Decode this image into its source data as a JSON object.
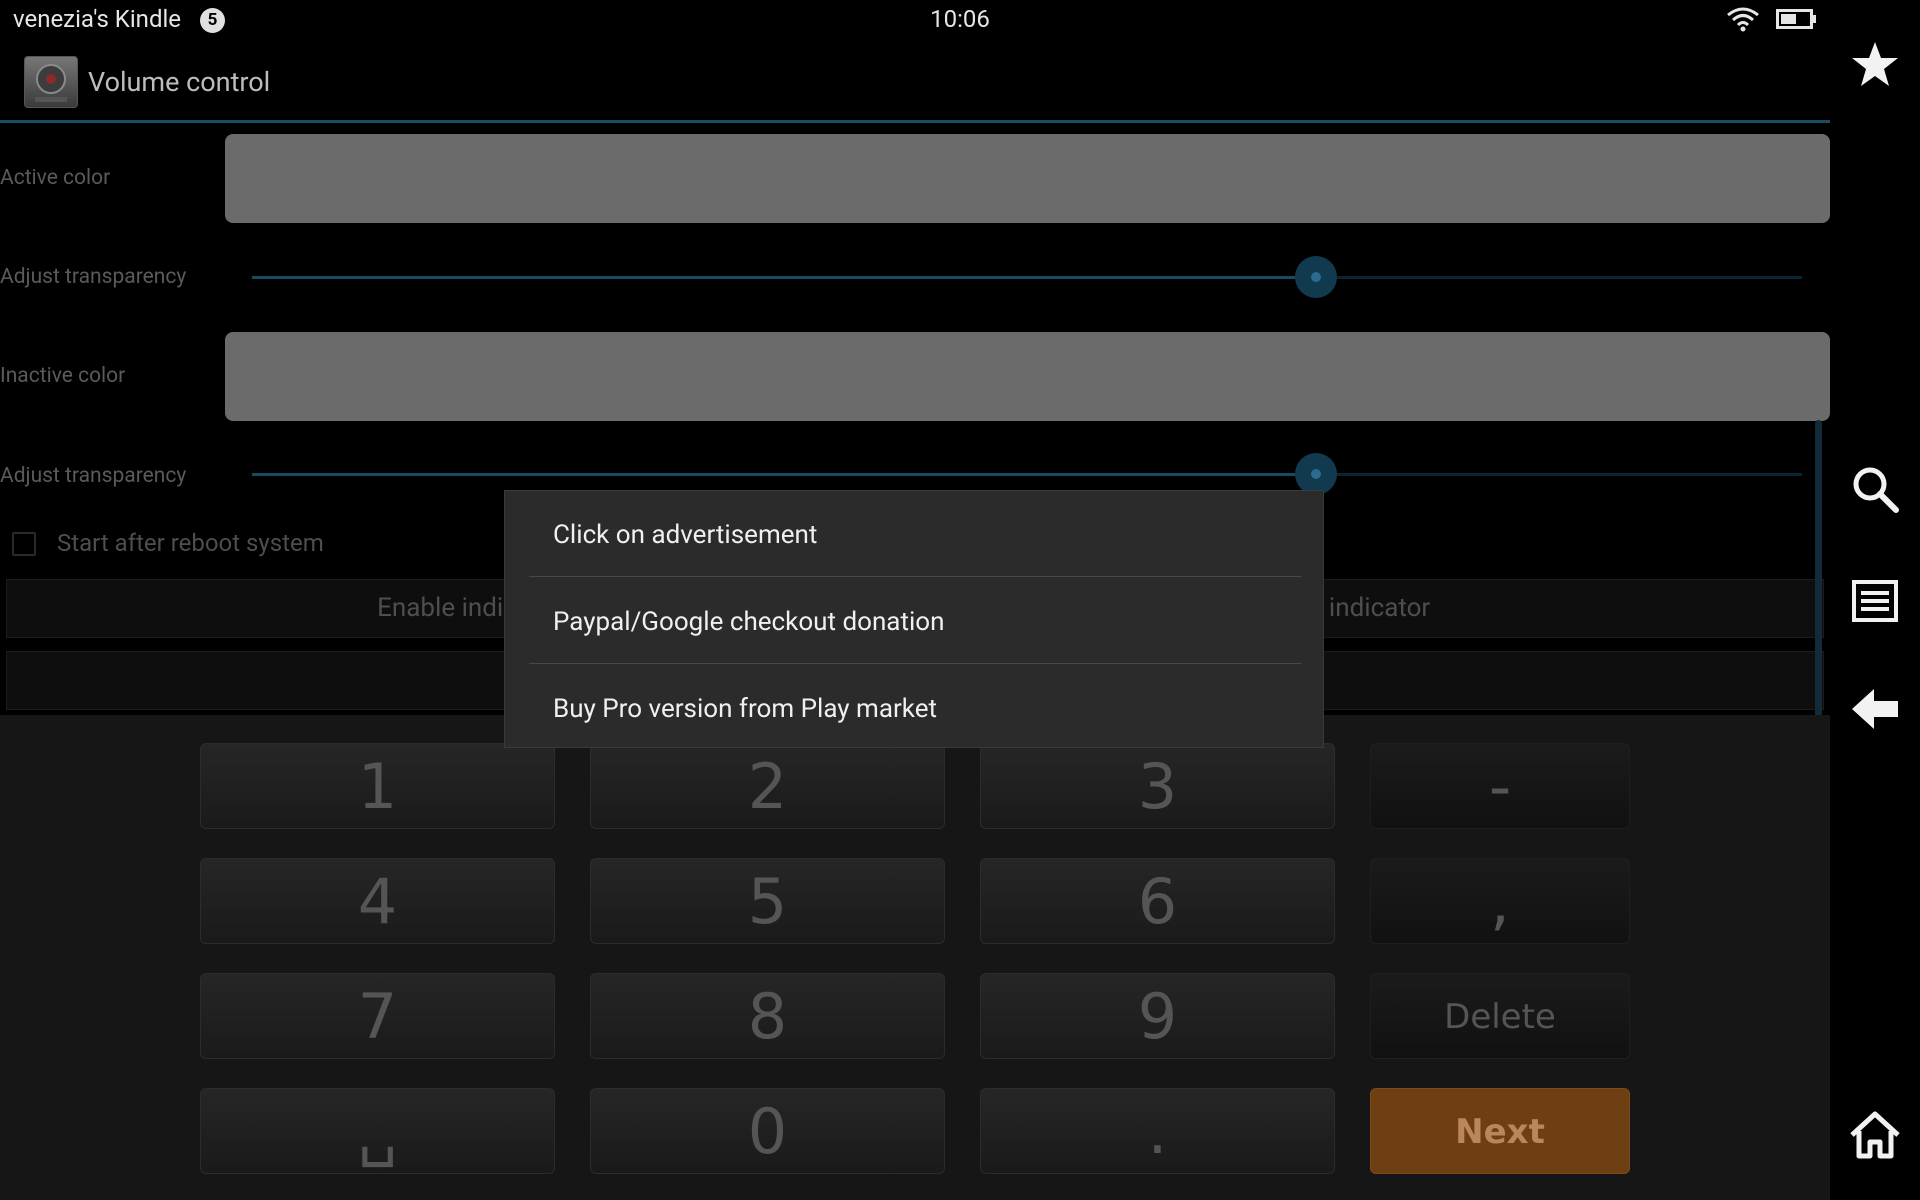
{
  "status_bar": {
    "device_name": "venezia's Kindle",
    "notification_count": "5",
    "time": "10:06"
  },
  "action_bar": {
    "title": "Volume control"
  },
  "settings": {
    "active_color_label": "Active color",
    "adjust_transparency_label_1": "Adjust transparency",
    "inactive_color_label": "Inactive color",
    "adjust_transparency_label_2": "Adjust transparency",
    "start_after_reboot_label": "Start after reboot system",
    "start_after_reboot_checked": false,
    "enable_indicator_label": "Enable indic",
    "disable_indicator_label": "ble indicator",
    "transparency_1_value": 0.69,
    "transparency_2_value": 0.69,
    "swatch_color": "#6b6b6b",
    "accent_color": "#1c4c66"
  },
  "popup_menu": {
    "items": [
      "Click on advertisement",
      "Paypal/Google checkout donation",
      "Buy Pro version from Play market"
    ]
  },
  "keypad": {
    "keys": [
      "1",
      "2",
      "3",
      "-",
      "4",
      "5",
      "6",
      ",",
      "7",
      "8",
      "9",
      "Delete",
      "␣",
      "0",
      ".",
      "Next"
    ],
    "next_color": "#6f3f14"
  },
  "nav_bar": {
    "icons": [
      "star-icon",
      "search-icon",
      "menu-icon",
      "back-arrow-icon",
      "home-icon"
    ]
  }
}
